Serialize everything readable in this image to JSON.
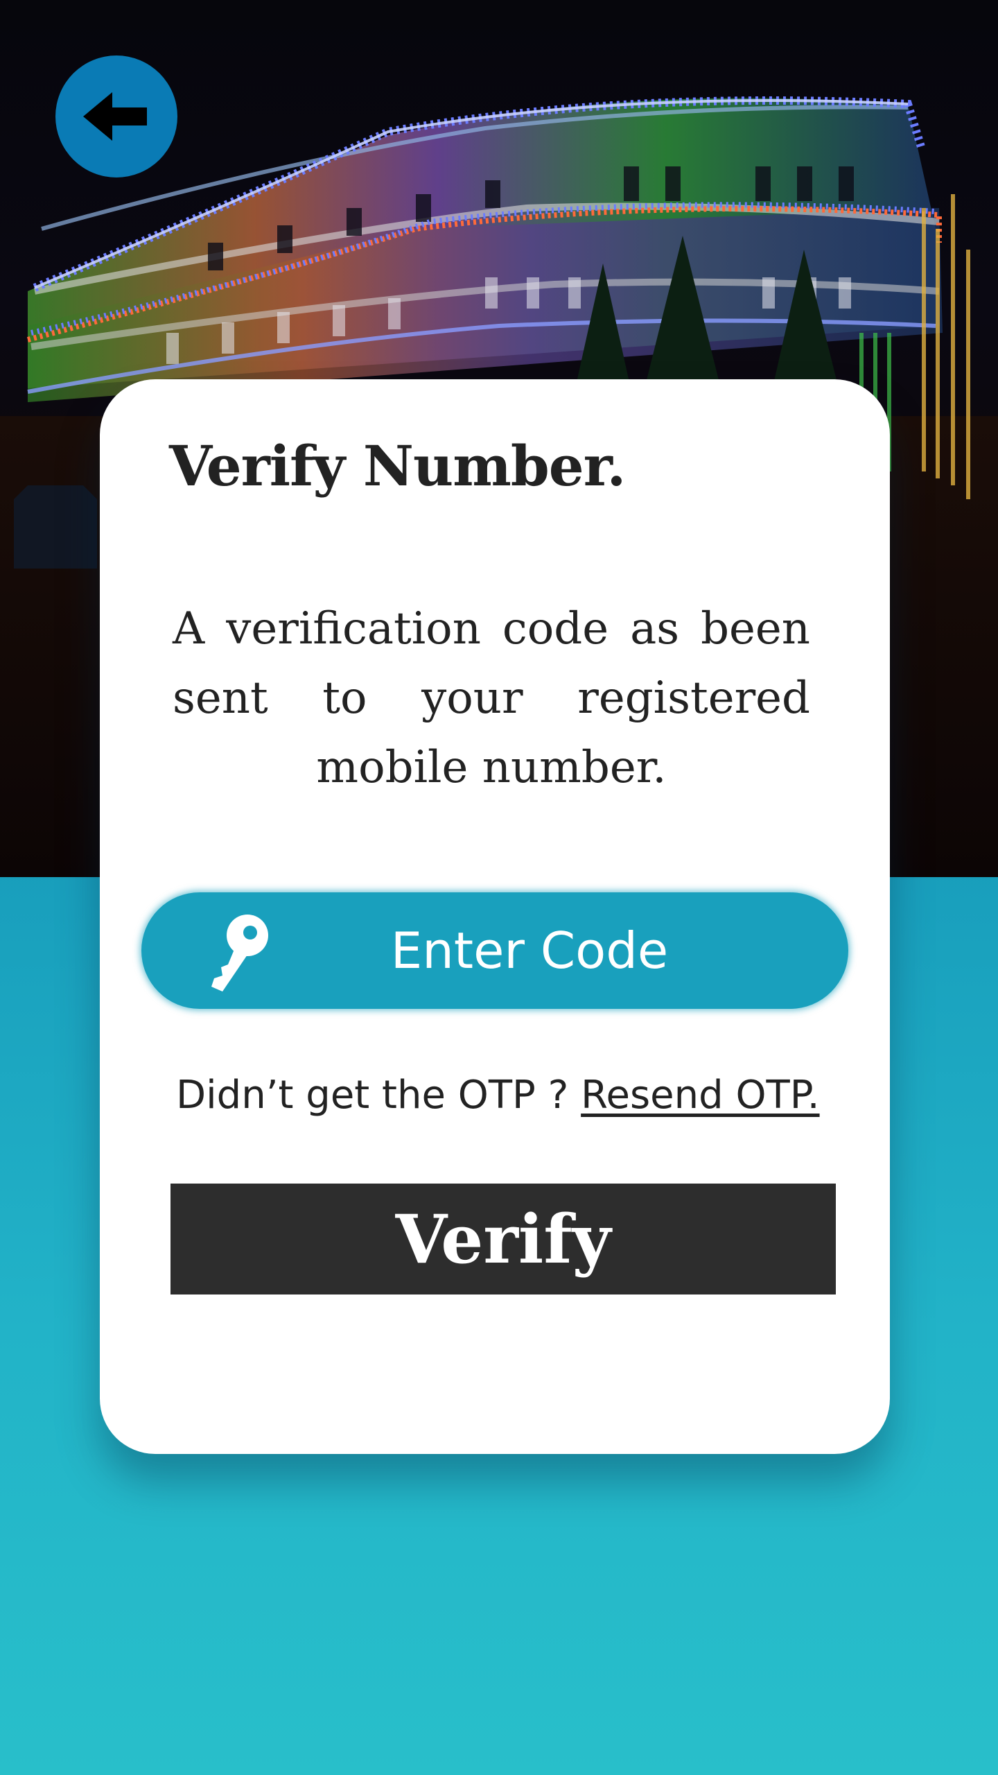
{
  "header": {
    "back_icon": "arrow-left-icon"
  },
  "card": {
    "title": "Verify Number.",
    "description": "A verification code as been sent to your registered mobile number."
  },
  "code_field": {
    "icon": "key-icon",
    "placeholder": "Enter Code",
    "value": ""
  },
  "resend": {
    "prompt": "Didn’t get the OTP ? ",
    "link_label": "Resend OTP."
  },
  "verify_button": {
    "label": "Verify"
  },
  "colors": {
    "accent_blue": "#0a7bb5",
    "input_teal": "#19a0bd",
    "button_dark": "#2d2d2d",
    "background_top": "#0c76a8",
    "background_bottom": "#28bfca"
  }
}
